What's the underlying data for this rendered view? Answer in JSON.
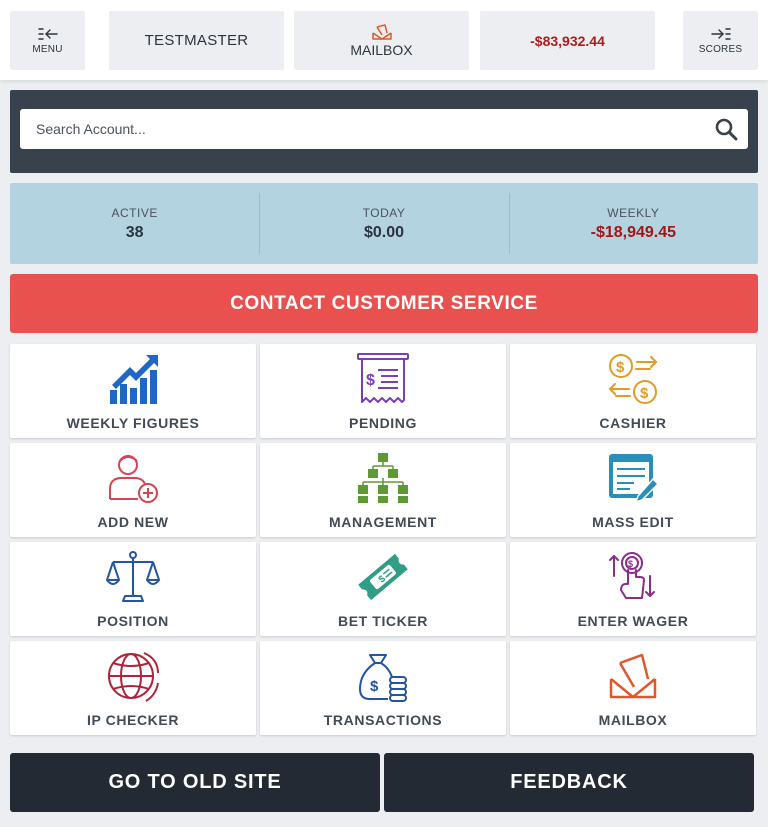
{
  "topbar": {
    "menu_label": "MENU",
    "user_label": "TESTMASTER",
    "mailbox_label": "MAILBOX",
    "balance": "-$83,932.44",
    "scores_label": "SCORES"
  },
  "search": {
    "placeholder": "Search Account..."
  },
  "stats": [
    {
      "label": "ACTIVE",
      "value": "38"
    },
    {
      "label": "TODAY",
      "value": "$0.00"
    },
    {
      "label": "WEEKLY",
      "value": "-$18,949.45"
    }
  ],
  "contact_label": "CONTACT CUSTOMER SERVICE",
  "tiles": [
    {
      "label": "WEEKLY FIGURES",
      "icon": "chart-up-icon"
    },
    {
      "label": "PENDING",
      "icon": "receipt-icon"
    },
    {
      "label": "CASHIER",
      "icon": "exchange-icon"
    },
    {
      "label": "ADD NEW",
      "icon": "add-user-icon"
    },
    {
      "label": "MANAGEMENT",
      "icon": "org-chart-icon"
    },
    {
      "label": "MASS EDIT",
      "icon": "edit-list-icon"
    },
    {
      "label": "POSITION",
      "icon": "scale-icon"
    },
    {
      "label": "BET TICKER",
      "icon": "ticket-icon"
    },
    {
      "label": "ENTER WAGER",
      "icon": "hand-coin-icon"
    },
    {
      "label": "IP CHECKER",
      "icon": "globe-icon"
    },
    {
      "label": "TRANSACTIONS",
      "icon": "money-bag-icon"
    },
    {
      "label": "MAILBOX",
      "icon": "envelope-icon"
    }
  ],
  "bottom": {
    "old_site_label": "GO TO OLD SITE",
    "feedback_label": "FEEDBACK"
  },
  "colors": {
    "dark": "#37424d",
    "stats_bg": "#b3d3e0",
    "contact": "#e9514e",
    "negative": "#a31515",
    "icon_blue": "#1f67c6",
    "icon_purple": "#7b3fb5",
    "icon_orange": "#e59a22",
    "icon_red": "#d64551",
    "icon_green": "#5e9a33",
    "icon_teal": "#2a8fb8",
    "icon_magenta": "#8f2b8f",
    "icon_mail": "#e0582a"
  }
}
